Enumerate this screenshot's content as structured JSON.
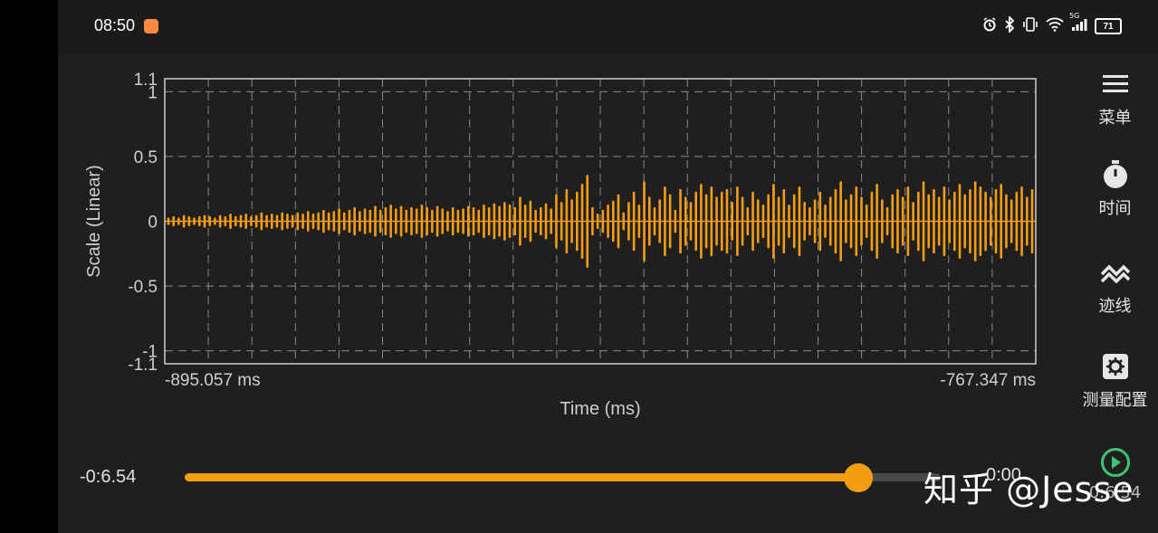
{
  "status_bar": {
    "time": "08:50",
    "network": "5G",
    "battery": "71",
    "icons": [
      "alarm-icon",
      "bluetooth-icon",
      "vibrate-icon",
      "wifi-icon",
      "signal-icon",
      "battery-icon"
    ]
  },
  "chart_data": {
    "type": "line",
    "ylabel": "Scale (Linear)",
    "xlabel": "Time (ms)",
    "ylim": [
      -1.1,
      1.1
    ],
    "y_ticks": [
      "1.1",
      "1",
      "0.5",
      "0",
      "-0.5",
      "-1",
      "-1.1"
    ],
    "x_range_labels": [
      "-895.057 ms",
      "-767.347 ms"
    ],
    "xlim": [
      -895.057,
      -767.347
    ],
    "grid": true,
    "series": [
      {
        "color": "#f49d12",
        "amplitudes": [
          0.02,
          0.03,
          0.02,
          0.04,
          0.03,
          0.02,
          0.03,
          0.04,
          0.03,
          0.02,
          0.04,
          0.03,
          0.05,
          0.03,
          0.04,
          0.05,
          0.03,
          0.04,
          0.06,
          0.04,
          0.05,
          0.04,
          0.06,
          0.05,
          0.04,
          0.06,
          0.05,
          0.07,
          0.05,
          0.06,
          0.08,
          0.06,
          0.07,
          0.09,
          0.06,
          0.08,
          0.1,
          0.07,
          0.09,
          0.08,
          0.11,
          0.08,
          0.1,
          0.12,
          0.09,
          0.11,
          0.08,
          0.1,
          0.09,
          0.12,
          0.1,
          0.08,
          0.11,
          0.09,
          0.07,
          0.1,
          0.08,
          0.09,
          0.11,
          0.1,
          0.08,
          0.12,
          0.1,
          0.13,
          0.11,
          0.14,
          0.12,
          0.1,
          0.18,
          0.12,
          0.15,
          0.08,
          0.1,
          0.13,
          0.09,
          0.2,
          0.14,
          0.24,
          0.16,
          0.22,
          0.28,
          0.35,
          0.1,
          0.05,
          0.08,
          0.12,
          0.15,
          0.2,
          0.06,
          0.14,
          0.22,
          0.12,
          0.3,
          0.18,
          0.1,
          0.16,
          0.26,
          0.2,
          0.08,
          0.24,
          0.18,
          0.14,
          0.22,
          0.28,
          0.2,
          0.26,
          0.18,
          0.22,
          0.24,
          0.14,
          0.26,
          0.18,
          0.1,
          0.22,
          0.16,
          0.12,
          0.2,
          0.28,
          0.18,
          0.24,
          0.12,
          0.2,
          0.26,
          0.14,
          0.1,
          0.16,
          0.22,
          0.12,
          0.18,
          0.24,
          0.3,
          0.16,
          0.2,
          0.26,
          0.18,
          0.12,
          0.22,
          0.28,
          0.16,
          0.1,
          0.2,
          0.24,
          0.18,
          0.26,
          0.14,
          0.22,
          0.3,
          0.2,
          0.24,
          0.18,
          0.26,
          0.16,
          0.22,
          0.28,
          0.2,
          0.24,
          0.3,
          0.26,
          0.22,
          0.18,
          0.24,
          0.28,
          0.2,
          0.16,
          0.22,
          0.26,
          0.18,
          0.24
        ]
      }
    ]
  },
  "side_menu": [
    {
      "icon": "menu-icon",
      "label": "菜单"
    },
    {
      "icon": "stopwatch-icon",
      "label": "时间"
    },
    {
      "icon": "trace-icon",
      "label": "迹线"
    },
    {
      "icon": "settings-icon",
      "label": "测量配置"
    },
    {
      "icon": "play-icon",
      "label": "0:6.54"
    }
  ],
  "playback": {
    "elapsed": "-0:6.54",
    "remaining": "0:00",
    "progress": 0.891,
    "accent": "#f49d12",
    "play_color": "#3ec46d"
  },
  "watermark": "知乎 @Jesse"
}
